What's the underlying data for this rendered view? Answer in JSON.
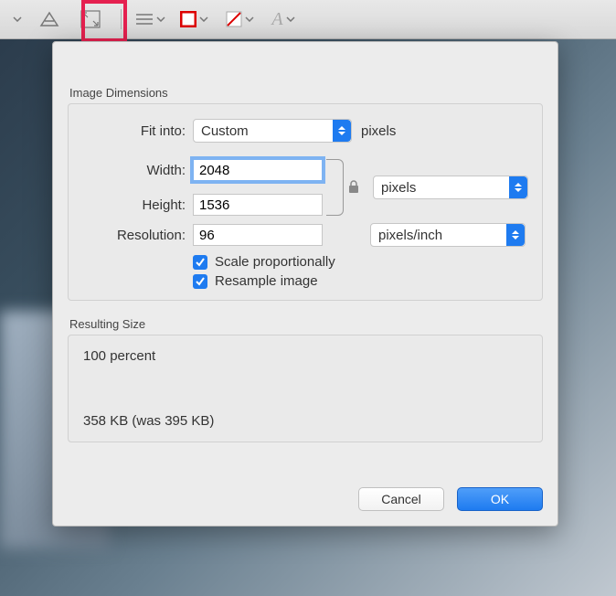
{
  "dialog": {
    "sectionTitle": "Image Dimensions",
    "fitIntoLabel": "Fit into:",
    "fitIntoValue": "Custom",
    "fitIntoUnit": "pixels",
    "widthLabel": "Width:",
    "widthValue": "2048",
    "heightLabel": "Height:",
    "heightValue": "1536",
    "whUnitValue": "pixels",
    "resolutionLabel": "Resolution:",
    "resolutionValue": "96",
    "resolutionUnitValue": "pixels/inch",
    "scaleProportionallyLabel": "Scale proportionally",
    "resampleLabel": "Resample image",
    "resultingTitle": "Resulting Size",
    "resultingPercent": "100 percent",
    "resultingBytes": "358 KB (was 395 KB)",
    "cancelLabel": "Cancel",
    "okLabel": "OK"
  }
}
